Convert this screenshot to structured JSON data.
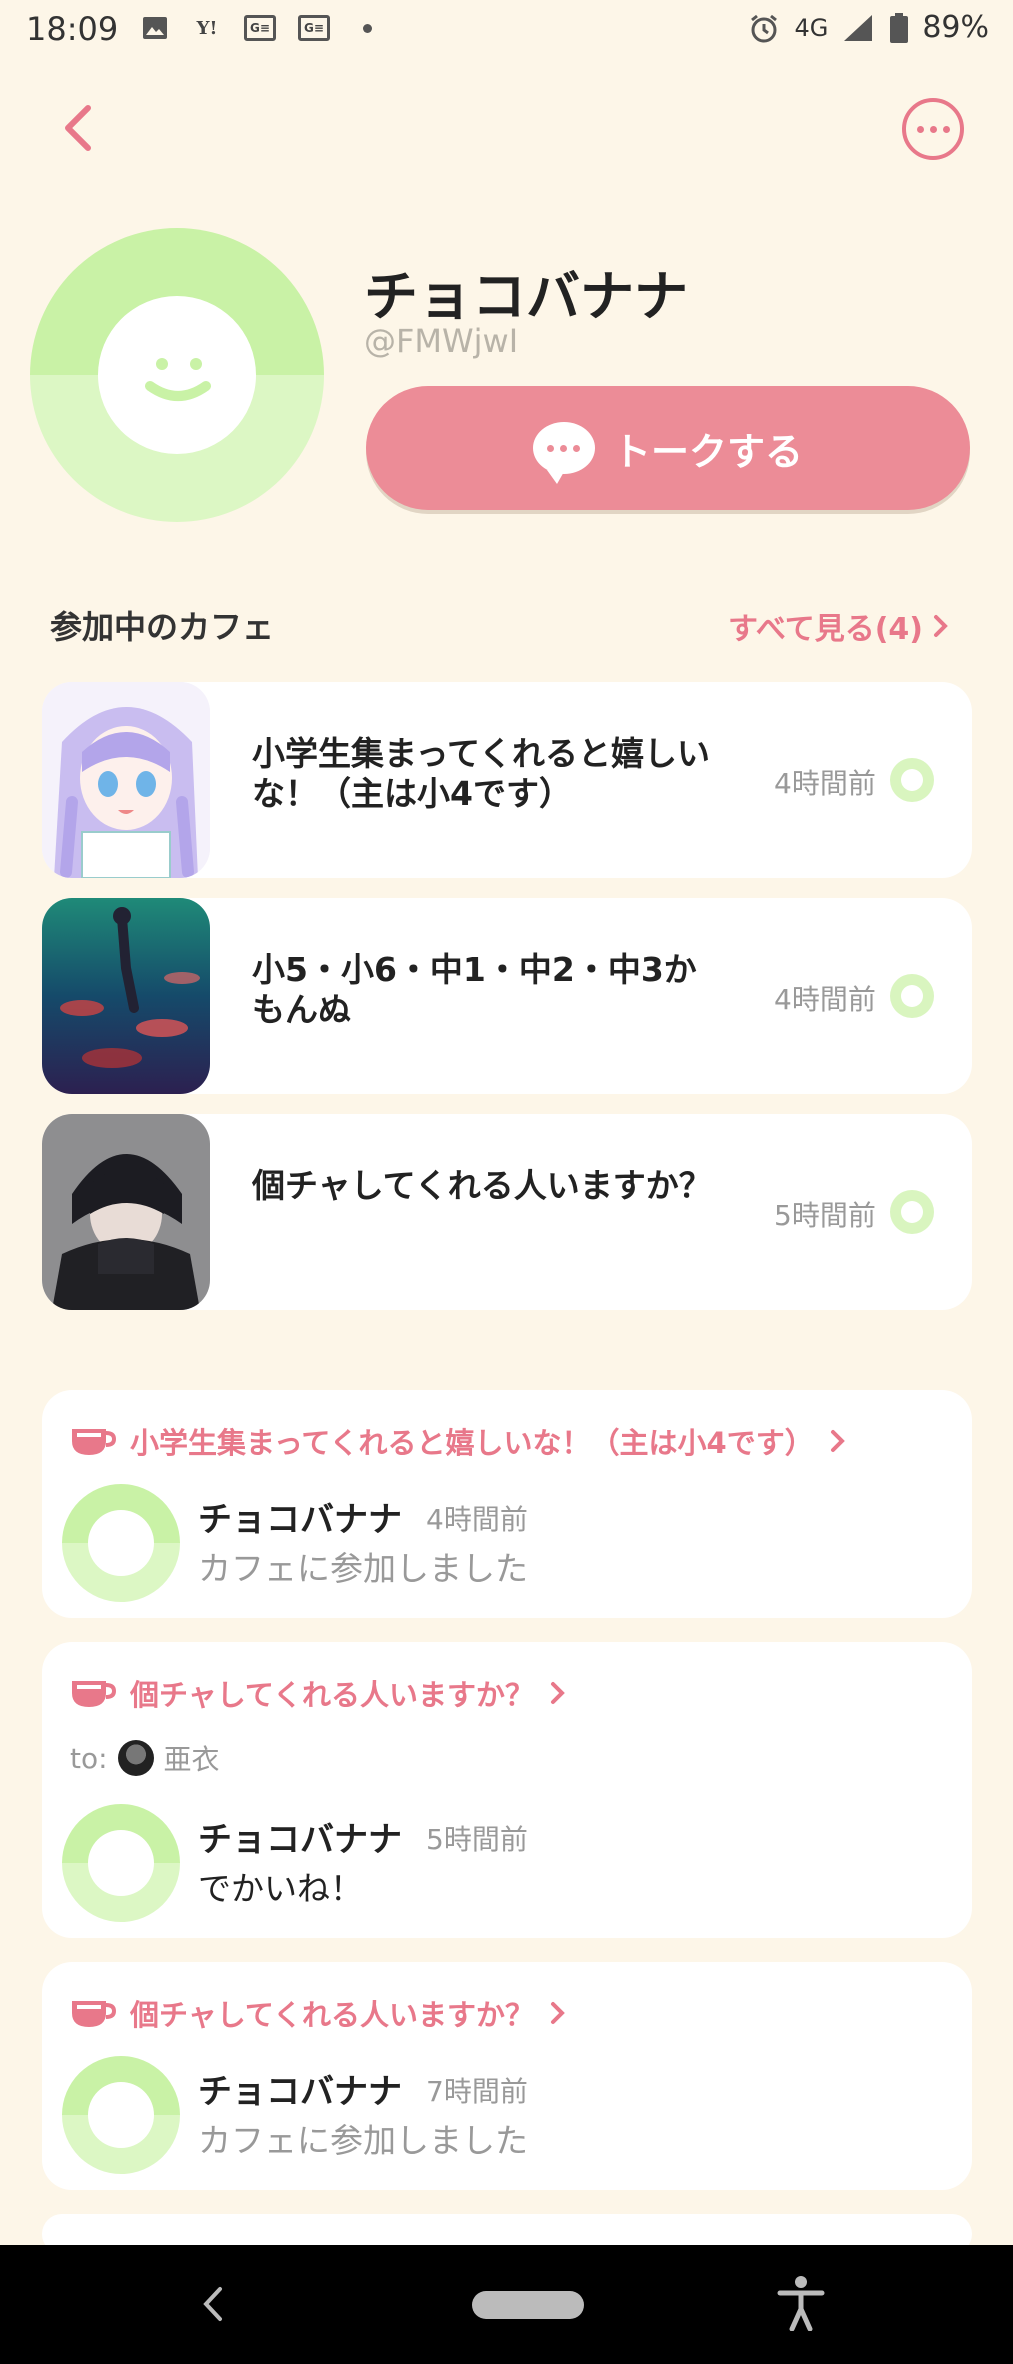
{
  "status": {
    "time": "18:09",
    "network": "4G",
    "battery": "89%",
    "notif_icons": [
      "image-icon",
      "yahoo-icon",
      "news-icon",
      "news-icon",
      "dot-icon"
    ]
  },
  "profile": {
    "name": "チョコバナナ",
    "handle": "@FMWjwI",
    "talk_label": "トークする"
  },
  "cafes_section": {
    "title": "参加中のカフェ",
    "see_all": "すべて見る(4)"
  },
  "cafes": [
    {
      "name": "小学生集まってくれると嬉しいな！（主は小4です）",
      "time": "4時間前"
    },
    {
      "name": "小5・小6・中1・中2・中3かもんぬ",
      "time": "4時間前"
    },
    {
      "name": "個チャしてくれる人いますか？",
      "time": "5時間前"
    }
  ],
  "activities": [
    {
      "cafe": "小学生集まってくれると嬉しいな！（主は小4です）",
      "user": "チョコバナナ",
      "time": "4時間前",
      "text": "カフェに参加しました"
    },
    {
      "cafe": "個チャしてくれる人いますか？",
      "to_label": "to:",
      "to_user": "亜衣",
      "user": "チョコバナナ",
      "time": "5時間前",
      "text": "でかいね！"
    },
    {
      "cafe": "個チャしてくれる人いますか？",
      "user": "チョコバナナ",
      "time": "7時間前",
      "text": "カフェに参加しました"
    }
  ],
  "colors": {
    "background": "#fdf6e8",
    "accent": "#ec8c97",
    "avatar_green": "#c9f2a6"
  }
}
